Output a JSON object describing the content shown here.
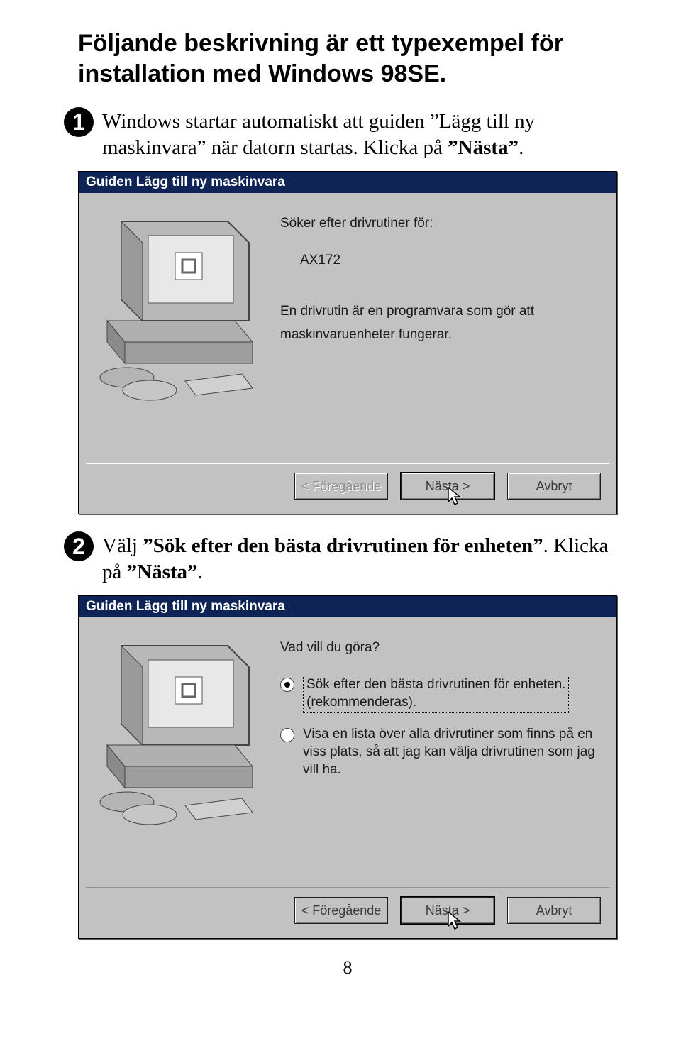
{
  "heading": "Följande beskrivning är ett typexempel för installation med Windows 98SE.",
  "step1": {
    "num": "1",
    "text_pre": "Windows startar automatiskt att guiden ”Lägg till ny maskinvara” när datorn startas. Klicka på ",
    "text_bold": "”Nästa”",
    "text_post": "."
  },
  "step2": {
    "num": "2",
    "text_pre": "Välj ",
    "text_bold": "”Sök efter den bästa drivrutinen för enheten”",
    "text_post": ". Klicka på ",
    "text_bold2": "”Nästa”",
    "text_post2": "."
  },
  "dlg1": {
    "title": "Guiden Lägg till ny maskinvara",
    "search_label": "Söker efter drivrutiner för:",
    "device": "AX172",
    "desc1": "En drivrutin är en programvara som gör att",
    "desc2": "maskinvaruenheter fungerar.",
    "btn_back": "< Föregående",
    "btn_next": "Nästa >",
    "btn_cancel": "Avbryt"
  },
  "dlg2": {
    "title": "Guiden Lägg till ny maskinvara",
    "prompt": "Vad vill du göra?",
    "opt1a": "Sök efter den bästa drivrutinen för enheten.",
    "opt1b": "(rekommenderas).",
    "opt2a": "Visa en lista över alla drivrutiner som finns på en",
    "opt2b": "viss plats, så att jag kan välja drivrutinen som jag",
    "opt2c": "vill ha.",
    "btn_back": "< Föregående",
    "btn_next": "Nästa >",
    "btn_cancel": "Avbryt"
  },
  "page_number": "8"
}
